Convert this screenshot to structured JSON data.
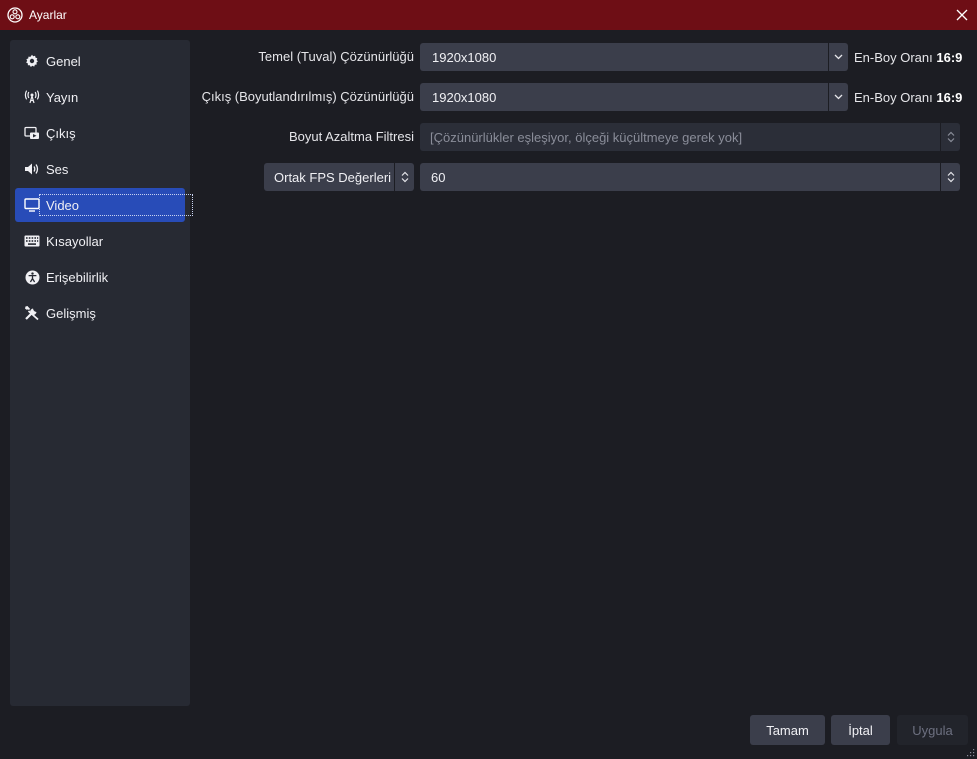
{
  "window": {
    "title": "Ayarlar"
  },
  "sidebar": {
    "items": [
      {
        "label": "Genel",
        "icon": "gear-icon"
      },
      {
        "label": "Yayın",
        "icon": "antenna-icon"
      },
      {
        "label": "Çıkış",
        "icon": "output-icon"
      },
      {
        "label": "Ses",
        "icon": "speaker-icon"
      },
      {
        "label": "Video",
        "icon": "monitor-icon",
        "active": true
      },
      {
        "label": "Kısayollar",
        "icon": "keyboard-icon"
      },
      {
        "label": "Erişebilirlik",
        "icon": "accessibility-icon"
      },
      {
        "label": "Gelişmiş",
        "icon": "tools-icon"
      }
    ]
  },
  "video": {
    "base_resolution": {
      "label": "Temel (Tuval) Çözünürlüğü",
      "value": "1920x1080",
      "aspect_label": "En-Boy Oranı",
      "aspect_value": "16:9"
    },
    "output_resolution": {
      "label": "Çıkış (Boyutlandırılmış) Çözünürlüğü",
      "value": "1920x1080",
      "aspect_label": "En-Boy Oranı",
      "aspect_value": "16:9"
    },
    "downscale_filter": {
      "label": "Boyut Azaltma Filtresi",
      "value": "[Çözünürlükler eşleşiyor, ölçeği küçültmeye gerek yok]"
    },
    "fps": {
      "type_label": "Ortak FPS Değerleri",
      "value": "60"
    }
  },
  "buttons": {
    "ok": "Tamam",
    "cancel": "İptal",
    "apply": "Uygula"
  },
  "colors": {
    "titlebar": "#6e0e15",
    "accent": "#284cb8",
    "background": "#1c1d23",
    "panel": "#272a33",
    "control": "#3b3e4b"
  }
}
